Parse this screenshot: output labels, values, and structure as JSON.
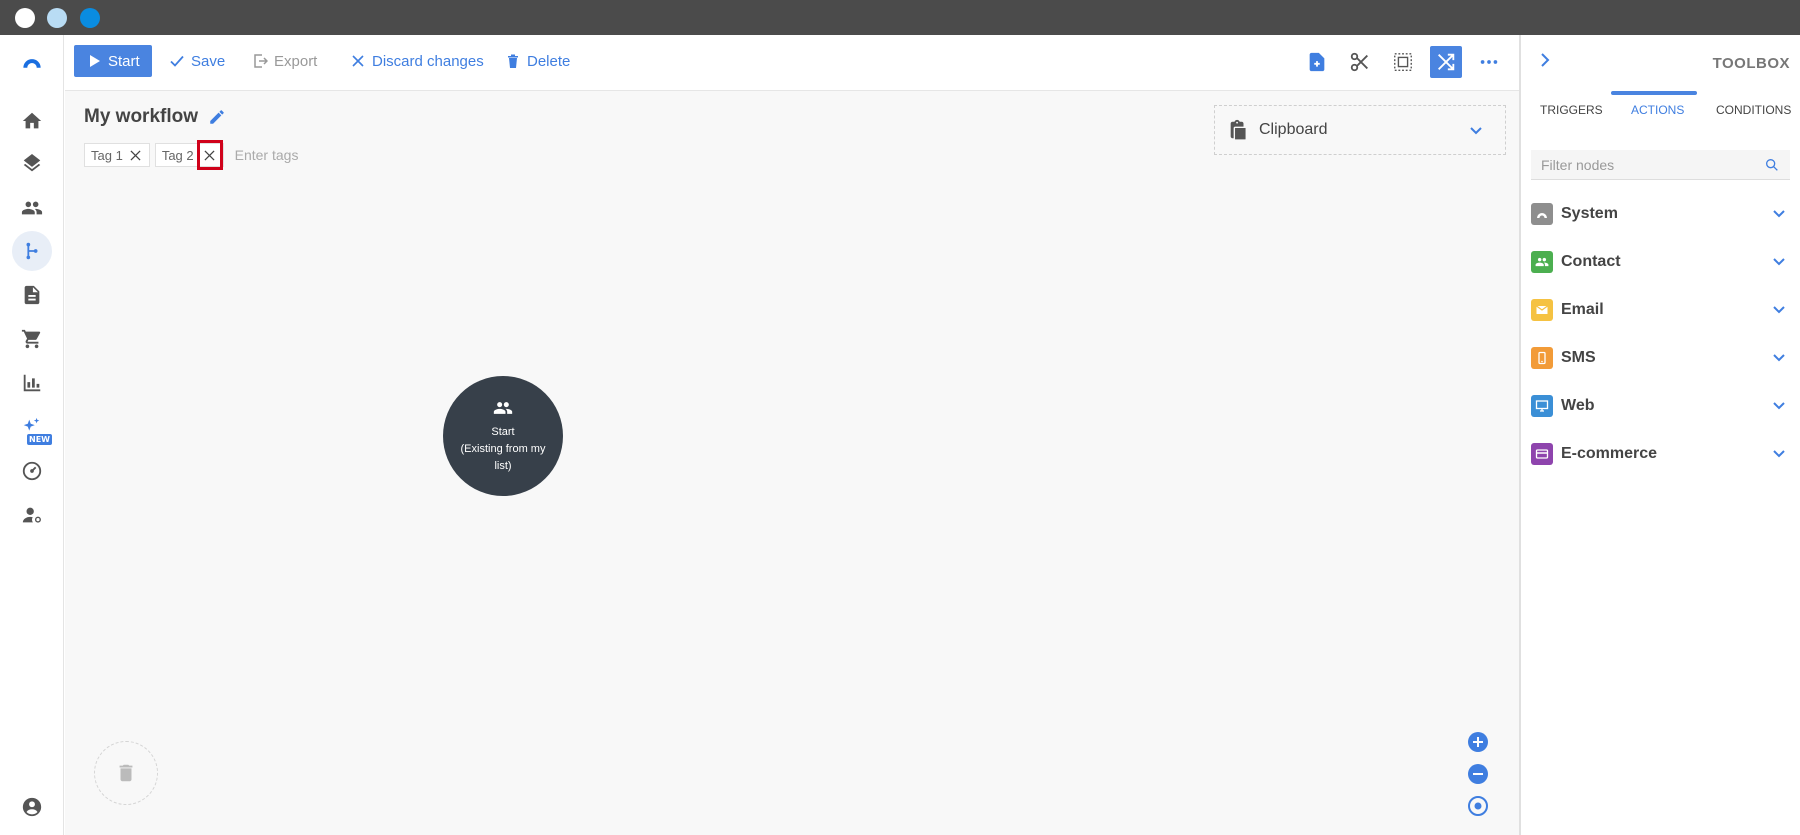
{
  "window": {
    "controls": [
      "close",
      "minimize",
      "maximize"
    ]
  },
  "colors": {
    "accent": "#4a84e0",
    "node": "#37404a",
    "highlight": "#d0021b"
  },
  "nav": {
    "items": [
      {
        "name": "home-icon"
      },
      {
        "name": "layers-icon"
      },
      {
        "name": "contacts-icon"
      },
      {
        "name": "workflow-icon",
        "active": true
      },
      {
        "name": "document-icon"
      },
      {
        "name": "cart-icon"
      },
      {
        "name": "chart-icon"
      },
      {
        "name": "sparkles-icon",
        "badge": "NEW"
      },
      {
        "name": "dashboard-icon"
      },
      {
        "name": "user-settings-icon"
      },
      {
        "name": "account-icon"
      }
    ]
  },
  "toolbar": {
    "start_label": "Start",
    "save_label": "Save",
    "export_label": "Export",
    "discard_label": "Discard changes",
    "delete_label": "Delete"
  },
  "workflow": {
    "title": "My workflow",
    "tags": [
      "Tag 1",
      "Tag 2"
    ],
    "tags_placeholder": "Enter tags"
  },
  "clipboard": {
    "label": "Clipboard"
  },
  "start_node": {
    "label": "Start",
    "sublabel": "(Existing from my list)"
  },
  "toolbox": {
    "title": "TOOLBOX",
    "tabs": [
      "TRIGGERS",
      "ACTIONS",
      "CONDITIONS"
    ],
    "active_tab": "ACTIONS",
    "filter_placeholder": "Filter nodes",
    "categories": [
      {
        "label": "System",
        "color": "#8e8e8e"
      },
      {
        "label": "Contact",
        "color": "#4caf50"
      },
      {
        "label": "Email",
        "color": "#f5c242"
      },
      {
        "label": "SMS",
        "color": "#f29b38"
      },
      {
        "label": "Web",
        "color": "#3b8fd6"
      },
      {
        "label": "E-commerce",
        "color": "#8e44ad"
      }
    ]
  }
}
